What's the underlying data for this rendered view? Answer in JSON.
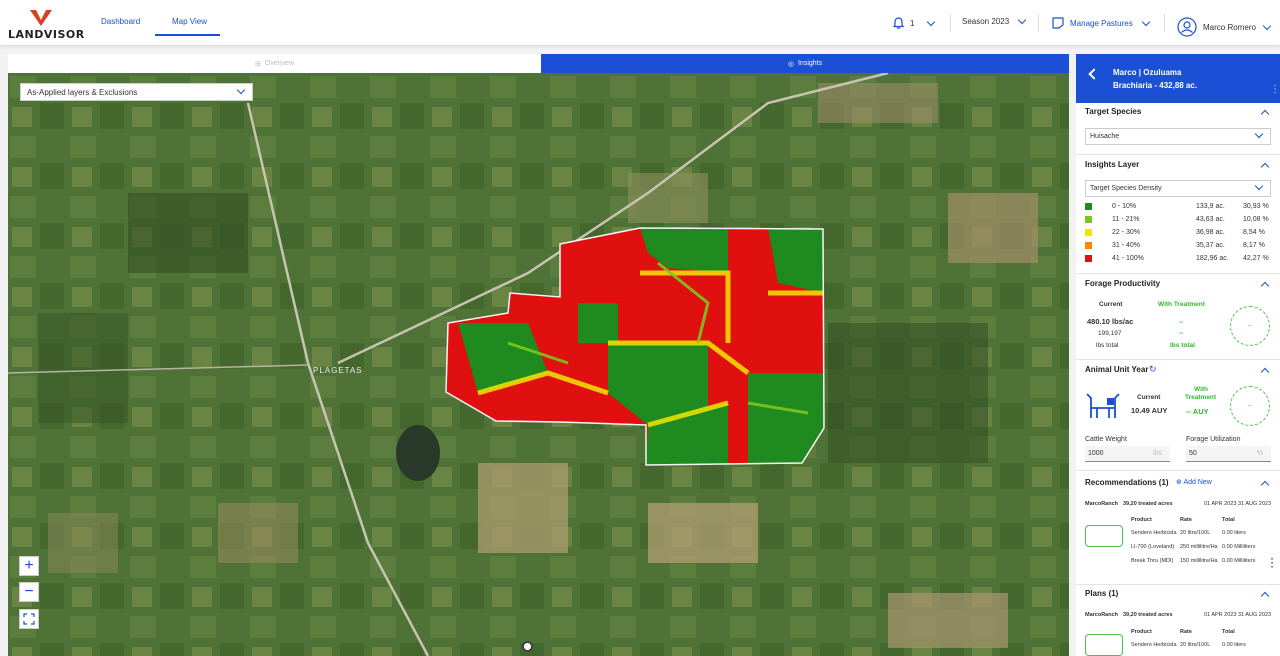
{
  "brand": {
    "name": "LANDVISOR",
    "accent": "#1a4fd6",
    "logo_red": "#d9401e"
  },
  "nav": {
    "dashboard": "Dashboard",
    "map_view": "Map View"
  },
  "header": {
    "notifications": "1",
    "season": "Season 2023",
    "manage": "Manage Pastures",
    "user": "Marco Romero"
  },
  "map_tabs": {
    "overview": "Overview",
    "insights": "Insights"
  },
  "map": {
    "layer_select": "As-Applied layers & Exclusions",
    "place_label": "PLAGETAS",
    "zoom_in": "+",
    "zoom_out": "−"
  },
  "panel": {
    "title": "Marco | Ozuluama",
    "subtitle": "Brachiaria - 432,88 ac.",
    "target_species": {
      "title": "Target Species",
      "value": "Huisache"
    },
    "insights_layer": {
      "title": "Insights Layer",
      "value": "Target Species Density",
      "legend": [
        {
          "range": "0 - 10%",
          "acres": "133,9 ac.",
          "pct": "30,93 %",
          "color": "#1f8a1f"
        },
        {
          "range": "11 - 21%",
          "acres": "43,63 ac.",
          "pct": "10,08 %",
          "color": "#7cc61c"
        },
        {
          "range": "22 - 30%",
          "acres": "36,98 ac.",
          "pct": "8,54 %",
          "color": "#f2e600"
        },
        {
          "range": "31 - 40%",
          "acres": "35,37 ac.",
          "pct": "8,17 %",
          "color": "#f28c00"
        },
        {
          "range": "41 - 100%",
          "acres": "182,96 ac.",
          "pct": "42,27 %",
          "color": "#e01010"
        }
      ]
    },
    "forage": {
      "title": "Forage Productivity",
      "current_label": "Current",
      "treated_label": "With Treatment",
      "current_value": "480.10 lbs/ac",
      "current_total": "199,197",
      "total_label": "lbs total",
      "treated_value": "--",
      "treated_total": "--",
      "treated_total_label": "lbs total",
      "circle": "--"
    },
    "auy": {
      "title": "Animal Unit Year",
      "current_label": "Current",
      "current_value": "10.49 AUY",
      "treated_label_1": "With",
      "treated_label_2": "Treatment",
      "treated_value": "-- AUY",
      "circle": "--",
      "cattle_weight_label": "Cattle Weight",
      "cattle_weight": "1000",
      "cattle_unit": "lbs",
      "forage_util_label": "Forage Utilization",
      "forage_util": "50",
      "forage_unit": "%"
    },
    "recommendations": {
      "title": "Recommendations (1)",
      "add_new": "Add New",
      "ranch": "MarcoRanch",
      "treated": "39,20 treated acres",
      "date_from": "01 APR 2023",
      "date_to": "31 AUG 2023",
      "col_product": "Product",
      "col_rate": "Rate",
      "col_total": "Total",
      "rows": [
        {
          "product": "Sendero Herbicida",
          "rate": "20 litre/100L",
          "total": "0.00 liters"
        },
        {
          "product": "LI-700 (Loveland)",
          "rate": "250 millilitre/Ha",
          "total": "0.00 Milliliters"
        },
        {
          "product": "Break Thru (MDI)",
          "rate": "150 millilitre/Ha",
          "total": "0.00 Milliliters"
        }
      ]
    },
    "plans": {
      "title": "Plans (1)",
      "ranch": "MarcoRanch",
      "treated": "39,20 treated acres",
      "date_from": "01 APR 2023",
      "date_to": "31 AUG 2023",
      "col_product": "Product",
      "col_rate": "Rate",
      "col_total": "Total",
      "row_product": "Sendero Herbicida",
      "row_rate": "20 litre/100L",
      "row_total": "0.00 liters"
    }
  }
}
